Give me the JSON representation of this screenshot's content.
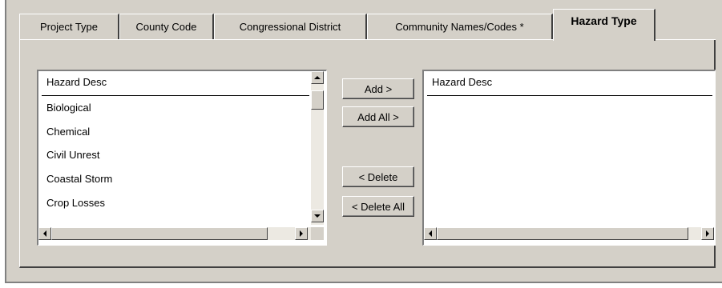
{
  "tabs": [
    {
      "label": "Project Type"
    },
    {
      "label": "County Code"
    },
    {
      "label": "Congressional District"
    },
    {
      "label": "Community Names/Codes *"
    },
    {
      "label": "Hazard Type"
    }
  ],
  "active_tab": "Hazard Type",
  "available_list": {
    "header": "Hazard Desc",
    "items": [
      "Biological",
      "Chemical",
      "Civil Unrest",
      "Coastal Storm",
      "Crop Losses"
    ]
  },
  "selected_list": {
    "header": "Hazard Desc",
    "items": []
  },
  "buttons": {
    "add": "Add >",
    "add_all": "Add All >",
    "delete": "< Delete",
    "delete_all": "< Delete All"
  },
  "icons": {
    "scroll_up": "triangle-up-icon",
    "scroll_down": "triangle-down-icon",
    "scroll_left": "triangle-left-icon",
    "scroll_right": "triangle-right-icon"
  }
}
